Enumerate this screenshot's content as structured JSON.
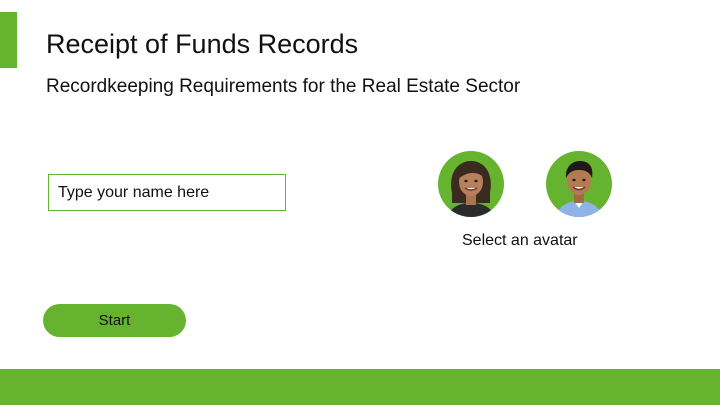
{
  "header": {
    "title": "Receipt of Funds Records",
    "subtitle": "Recordkeeping Requirements for the Real Estate Sector"
  },
  "form": {
    "name_placeholder": "Type your name here",
    "name_value": ""
  },
  "avatars": {
    "label": "Select an avatar",
    "options": [
      {
        "icon": "female-avatar-icon"
      },
      {
        "icon": "male-avatar-icon"
      }
    ]
  },
  "actions": {
    "start_label": "Start"
  },
  "colors": {
    "accent": "#65b32e",
    "background": "#ffffff",
    "text": "#111111"
  }
}
